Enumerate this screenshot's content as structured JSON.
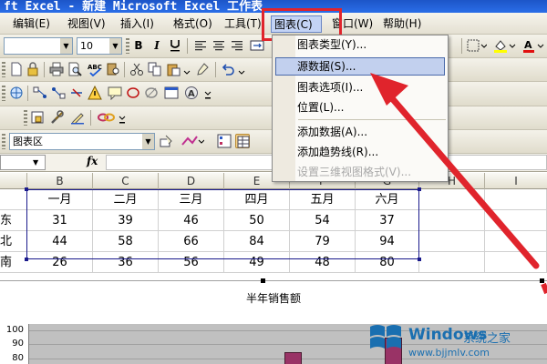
{
  "window": {
    "title": "ft Excel - 新建 Microsoft Excel 工作表"
  },
  "menubar": [
    {
      "label": "编辑(E)"
    },
    {
      "label": "视图(V)"
    },
    {
      "label": "插入(I)"
    },
    {
      "label": "格式(O)"
    },
    {
      "label": "工具(T)"
    },
    {
      "label": "图表(C)"
    },
    {
      "label": "窗口(W)"
    },
    {
      "label": "帮助(H)"
    }
  ],
  "format_toolbar": {
    "font_size": "10",
    "bold": "B",
    "italic": "I"
  },
  "chart_toolbar": {
    "chart_object": "图表区"
  },
  "formula_bar": {
    "fx": "fx"
  },
  "chart_menu": {
    "items": [
      {
        "label": "图表类型(Y)..."
      },
      {
        "label": "源数据(S)..."
      },
      {
        "label": "图表选项(I)..."
      },
      {
        "label": "位置(L)..."
      },
      {
        "label": "添加数据(A)..."
      },
      {
        "label": "添加趋势线(R)..."
      },
      {
        "label": "设置三维视图格式(V)..."
      }
    ]
  },
  "sheet": {
    "columns": [
      "B",
      "C",
      "D",
      "E",
      "F",
      "G",
      "H",
      "I"
    ],
    "header_row": [
      "一月",
      "二月",
      "三月",
      "四月",
      "五月",
      "六月"
    ],
    "rows": [
      {
        "label": "东",
        "values": [
          "31",
          "39",
          "46",
          "50",
          "54",
          "37"
        ]
      },
      {
        "label": "北",
        "values": [
          "44",
          "58",
          "66",
          "84",
          "79",
          "94"
        ]
      },
      {
        "label": "南",
        "values": [
          "26",
          "36",
          "56",
          "49",
          "48",
          "80"
        ]
      }
    ]
  },
  "chart": {
    "title": "半年销售额",
    "y_ticks": [
      "100",
      "90",
      "80"
    ]
  },
  "watermark": {
    "brand": "Windows",
    "subtitle": "系统之家",
    "url": "www.bjjmlv.com",
    "color": "#1a6fb0"
  },
  "colors": {
    "annotation": "#e0242c",
    "bar": "#993366",
    "menu_highlight": "#c2d0ee"
  }
}
